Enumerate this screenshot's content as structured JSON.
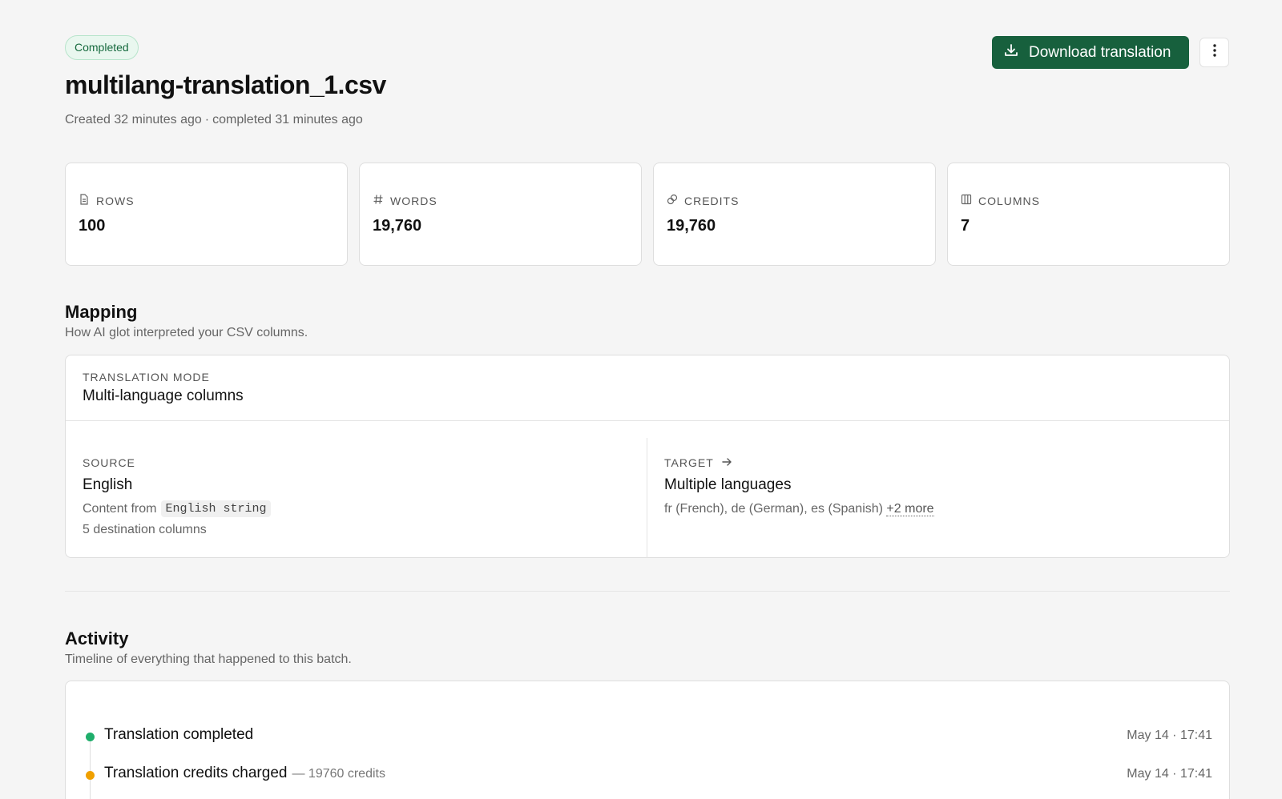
{
  "header": {
    "status_badge": "Completed",
    "file_name": "multilang-translation_1.csv",
    "created": "Created 32 minutes ago",
    "separator": "·",
    "completed": "completed 31 minutes ago",
    "download_label": "Download translation",
    "accent_color": "#17603d"
  },
  "stats": [
    {
      "icon": "file-icon",
      "label": "ROWS",
      "value": "100"
    },
    {
      "icon": "hash-icon",
      "label": "WORDS",
      "value": "19,760"
    },
    {
      "icon": "coins-icon",
      "label": "CREDITS",
      "value": "19,760"
    },
    {
      "icon": "columns-icon",
      "label": "COLUMNS",
      "value": "7"
    }
  ],
  "mapping": {
    "title": "Mapping",
    "description": "How AI glot interpreted your CSV columns.",
    "mode_label": "TRANSLATION MODE",
    "mode_value": "Multi-language columns",
    "source": {
      "label": "SOURCE",
      "value": "English",
      "content_prefix": "Content from",
      "content_column": "English string",
      "destination_columns": "5 destination columns"
    },
    "target": {
      "label": "TARGET",
      "value": "Multiple languages",
      "languages": "fr (French), de (German), es (Spanish)",
      "more_link": "+2 more"
    }
  },
  "activity": {
    "title": "Activity",
    "description": "Timeline of everything that happened to this batch.",
    "events": [
      {
        "text": "Translation completed",
        "extra": "",
        "time": "May 14 · 17:41",
        "dot_color": "#1fae6b"
      },
      {
        "text": "Translation credits charged",
        "extra": "— 19760 credits",
        "time": "May 14 · 17:41",
        "dot_color": "#f0a000"
      }
    ]
  }
}
